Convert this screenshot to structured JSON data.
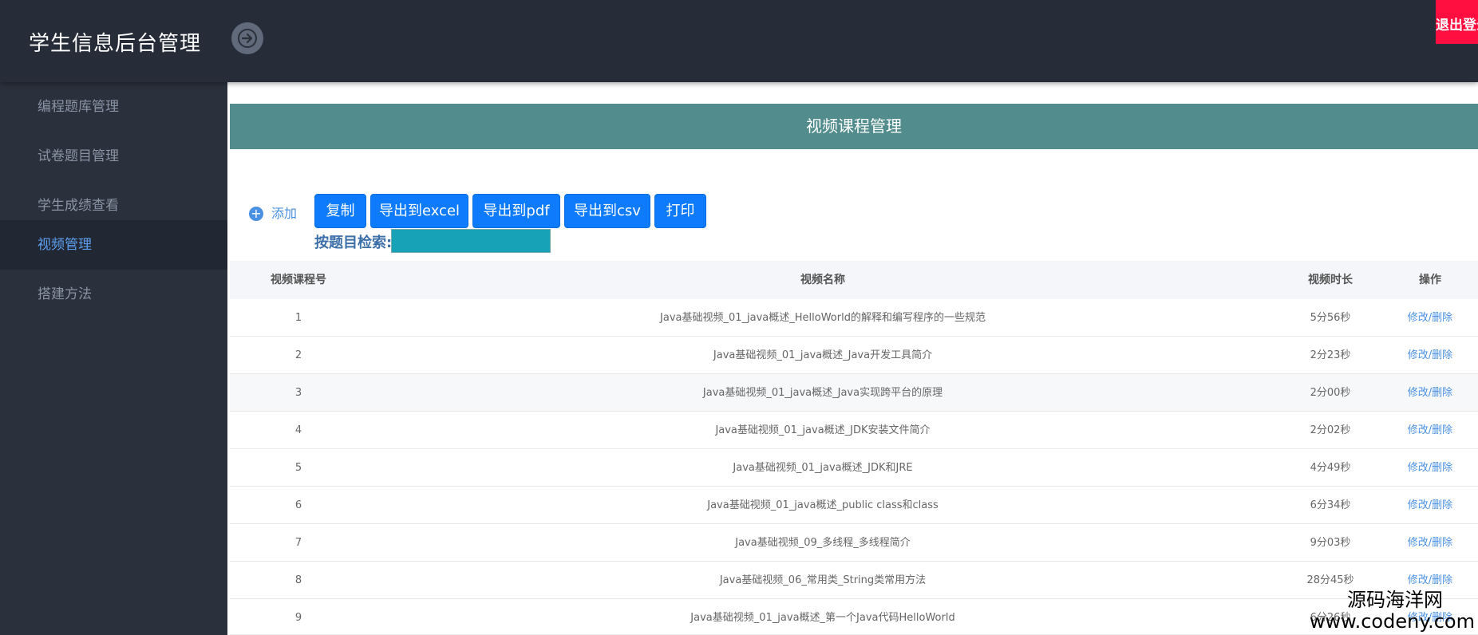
{
  "header": {
    "title": "学生信息后台管理",
    "logout_label": "退出登录"
  },
  "sidebar": {
    "items": [
      {
        "label": "编程题库管理"
      },
      {
        "label": "试卷题目管理"
      },
      {
        "label": "学生成绩查看"
      },
      {
        "label": "视频管理",
        "active": true
      },
      {
        "label": "搭建方法"
      }
    ]
  },
  "panel": {
    "title": "视频课程管理"
  },
  "toolbar": {
    "add_label": "添加",
    "copy_label": "复制",
    "excel_label": "导出到excel",
    "pdf_label": "导出到pdf",
    "csv_label": "导出到csv",
    "print_label": "打印"
  },
  "search": {
    "label": "按题目检索:",
    "value": ""
  },
  "table": {
    "headers": [
      "视频课程号",
      "视频名称",
      "视频时长",
      "操作"
    ],
    "rows": [
      {
        "id": "1",
        "name": "Java基础视频_01_java概述_HelloWorld的解释和编写程序的一些规范",
        "duration": "5分56秒",
        "ops": "修改/删除"
      },
      {
        "id": "2",
        "name": "Java基础视频_01_java概述_Java开发工具简介",
        "duration": "2分23秒",
        "ops": "修改/删除"
      },
      {
        "id": "3",
        "name": "Java基础视频_01_java概述_Java实现跨平台的原理",
        "duration": "2分00秒",
        "ops": "修改/删除"
      },
      {
        "id": "4",
        "name": "Java基础视频_01_java概述_JDK安装文件简介",
        "duration": "2分02秒",
        "ops": "修改/删除"
      },
      {
        "id": "5",
        "name": "Java基础视频_01_java概述_JDK和JRE",
        "duration": "4分49秒",
        "ops": "修改/删除"
      },
      {
        "id": "6",
        "name": "Java基础视频_01_java概述_public class和class",
        "duration": "6分34秒",
        "ops": "修改/删除"
      },
      {
        "id": "7",
        "name": "Java基础视频_09_多线程_多线程简介",
        "duration": "9分03秒",
        "ops": "修改/删除"
      },
      {
        "id": "8",
        "name": "Java基础视频_06_常用类_String类常用方法",
        "duration": "28分45秒",
        "ops": "修改/删除"
      },
      {
        "id": "9",
        "name": "Java基础视频_01_java概述_第一个Java代码HelloWorld",
        "duration": "6分26秒",
        "ops": "修改/删除"
      }
    ]
  },
  "watermark": {
    "cn": "源码海洋网",
    "url": "www.codeny.com"
  },
  "colors": {
    "header_bg": "#272d38",
    "sidebar_bg": "#2a303c",
    "panel_title_bg": "#528c8c",
    "button_blue": "#0d7bfb",
    "logout_red": "#ff0e3f",
    "link_blue": "#4a90e2"
  }
}
